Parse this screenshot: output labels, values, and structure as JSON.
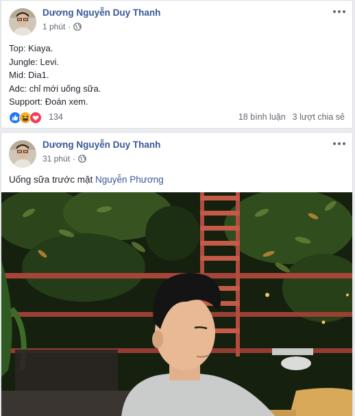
{
  "posts": [
    {
      "author": "Dương Nguyễn Duy Thanh",
      "time": "1 phút",
      "lines": [
        "Top: Kiaya.",
        "Jungle: Levi.",
        "Mid: Dia1.",
        "Adc: chỉ mới uống sữa.",
        "Support: Đoán xem."
      ],
      "reactions": {
        "icons": [
          "like-icon",
          "haha-icon",
          "love-icon"
        ],
        "count": "134"
      },
      "comments": "18 bình luận",
      "shares": "3 lượt chia sẻ"
    },
    {
      "author": "Dương Nguyễn Duy Thanh",
      "time": "31 phút",
      "text": "Uống sữa trước mặt",
      "mention": "Nguyễn Phương"
    }
  ],
  "colors": {
    "link": "#385898",
    "like": "#2078f4",
    "love": "#f33e58",
    "haha": "#f7b125"
  }
}
